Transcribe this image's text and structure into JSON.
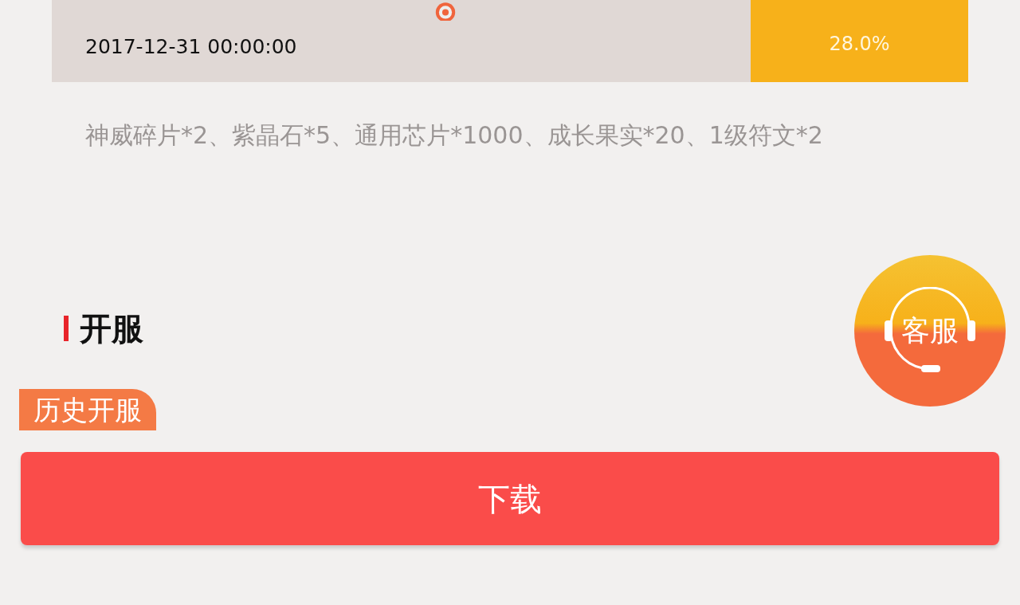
{
  "coupon": {
    "date": "2017-12-31 00:00:00",
    "rate": "28.0%",
    "description": "神威碎片*2、紫晶石*5、通用芯片*1000、成长果实*20、1级符文*2"
  },
  "section": {
    "title": "开服"
  },
  "tabs": [
    {
      "label": "历史开服",
      "selected": true
    }
  ],
  "service_button": {
    "label": "客服"
  },
  "download_button": {
    "label": "下载"
  }
}
